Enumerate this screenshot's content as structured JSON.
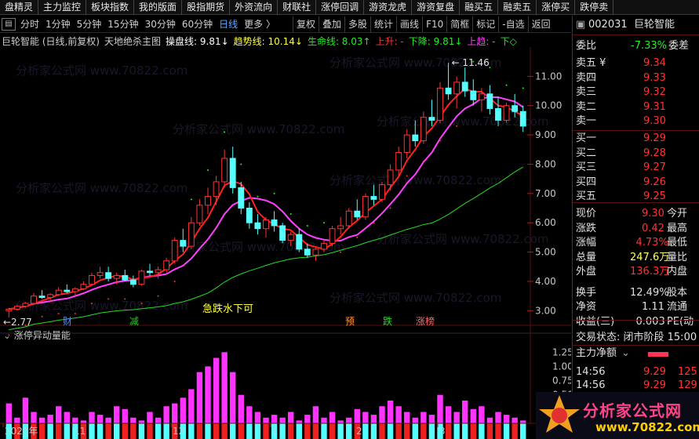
{
  "topbar": {
    "items": [
      "盘精灵",
      "主力监控",
      "板块指数",
      "我的版面",
      "股指期货",
      "外资流向",
      "财联社",
      "涨停回调",
      "游资龙虎",
      "游资复盘",
      "融买五",
      "融卖五",
      "涨停买",
      "跌停卖"
    ]
  },
  "toolbar": {
    "periods": [
      "分时",
      "1分钟",
      "5分钟",
      "15分钟",
      "30分钟",
      "60分钟",
      "日线",
      "更多 〉"
    ],
    "active": "日线",
    "tools": [
      "复权",
      "叠加",
      "多股",
      "统计",
      "画线",
      "F10",
      "简框",
      "标记",
      "-自选",
      "返回"
    ]
  },
  "legend": {
    "name": "巨轮智能 (日线,前复权)",
    "indicator": "天地绝杀主图",
    "l1": "操盘线: 9.81↓",
    "l2": "趋势线: 10.14↓",
    "l3": "生命线: 8.03↑",
    "l4": "上升: -",
    "l5": "下降: 9.81↓",
    "l6": "上趋: -",
    "l7": "下◇"
  },
  "chart": {
    "price_axis": [
      "11.00",
      "10.00",
      "9.00",
      "8.00",
      "7.00",
      "6.00",
      "5.00",
      "4.00",
      "3.00"
    ],
    "high_label": "11.46",
    "low_label": "2.77",
    "annotation": "急跌水下可",
    "markers": [
      {
        "text": "财",
        "color": "#4a90ff"
      },
      {
        "text": "减",
        "color": "#22cc22"
      },
      {
        "text": "预",
        "color": "#ff9933"
      },
      {
        "text": "跌",
        "color": "#22dd22"
      },
      {
        "text": "涨榜",
        "color": "#ff6666"
      }
    ],
    "vol_title": "涨停异动量能",
    "vol_axis": [
      "1.25",
      "1.00",
      "0.75",
      "0.50",
      "0.25"
    ],
    "time_axis": [
      "2024年",
      "11",
      "12",
      "1",
      "2",
      "3"
    ]
  },
  "chart_data": {
    "type": "candlestick",
    "y_range": [
      2.5,
      12.0
    ],
    "ohlc": [
      [
        3.0,
        3.1,
        2.77,
        3.05
      ],
      [
        3.05,
        3.2,
        3.0,
        3.15
      ],
      [
        3.15,
        3.3,
        3.1,
        3.25
      ],
      [
        3.25,
        3.6,
        3.2,
        3.5
      ],
      [
        3.5,
        3.7,
        3.4,
        3.45
      ],
      [
        3.45,
        3.6,
        3.3,
        3.55
      ],
      [
        3.55,
        3.8,
        3.5,
        3.7
      ],
      [
        3.7,
        3.9,
        3.6,
        3.65
      ],
      [
        3.65,
        3.8,
        3.5,
        3.75
      ],
      [
        3.75,
        4.0,
        3.7,
        3.9
      ],
      [
        3.9,
        4.3,
        3.85,
        4.2
      ],
      [
        4.2,
        4.5,
        4.1,
        4.3
      ],
      [
        4.3,
        4.5,
        4.0,
        4.1
      ],
      [
        4.1,
        4.3,
        3.9,
        4.2
      ],
      [
        4.2,
        4.4,
        4.0,
        4.05
      ],
      [
        4.05,
        4.2,
        3.8,
        3.9
      ],
      [
        3.9,
        4.4,
        3.85,
        4.35
      ],
      [
        4.35,
        4.6,
        4.2,
        4.3
      ],
      [
        4.3,
        4.5,
        4.1,
        4.4
      ],
      [
        4.4,
        4.8,
        4.3,
        4.7
      ],
      [
        4.7,
        5.5,
        4.6,
        5.4
      ],
      [
        5.4,
        5.8,
        5.0,
        5.2
      ],
      [
        5.2,
        6.2,
        5.1,
        6.0
      ],
      [
        6.0,
        6.8,
        5.9,
        6.6
      ],
      [
        6.6,
        7.2,
        6.3,
        6.9
      ],
      [
        6.9,
        7.6,
        6.6,
        7.4
      ],
      [
        7.4,
        8.5,
        7.2,
        8.2
      ],
      [
        8.2,
        8.6,
        7.0,
        7.2
      ],
      [
        7.2,
        7.4,
        6.3,
        6.5
      ],
      [
        6.5,
        6.7,
        5.8,
        6.0
      ],
      [
        6.0,
        6.3,
        5.6,
        5.8
      ],
      [
        5.8,
        6.2,
        5.5,
        6.1
      ],
      [
        6.1,
        6.4,
        5.7,
        5.9
      ],
      [
        5.9,
        6.0,
        5.3,
        5.4
      ],
      [
        5.4,
        5.7,
        5.2,
        5.6
      ],
      [
        5.6,
        5.8,
        5.0,
        5.1
      ],
      [
        5.1,
        5.3,
        4.8,
        4.9
      ],
      [
        4.9,
        5.2,
        4.7,
        5.1
      ],
      [
        5.1,
        5.4,
        5.0,
        5.3
      ],
      [
        5.3,
        5.9,
        5.2,
        5.8
      ],
      [
        5.8,
        6.2,
        5.6,
        5.9
      ],
      [
        5.9,
        6.5,
        5.8,
        6.4
      ],
      [
        6.4,
        6.8,
        6.1,
        6.2
      ],
      [
        6.2,
        7.0,
        6.1,
        6.9
      ],
      [
        6.9,
        7.3,
        6.6,
        6.8
      ],
      [
        6.8,
        7.4,
        6.7,
        7.3
      ],
      [
        7.3,
        8.0,
        7.1,
        7.8
      ],
      [
        7.8,
        8.6,
        7.6,
        8.4
      ],
      [
        8.4,
        9.2,
        8.2,
        9.0
      ],
      [
        9.0,
        9.5,
        8.6,
        8.8
      ],
      [
        8.8,
        9.8,
        8.7,
        9.6
      ],
      [
        9.6,
        10.2,
        9.3,
        9.5
      ],
      [
        9.5,
        10.8,
        9.4,
        10.6
      ],
      [
        10.6,
        11.46,
        10.2,
        10.4
      ],
      [
        10.4,
        11.0,
        9.9,
        10.8
      ],
      [
        10.8,
        11.3,
        10.3,
        10.5
      ],
      [
        10.5,
        10.9,
        10.0,
        10.2
      ],
      [
        10.2,
        10.6,
        9.8,
        10.4
      ],
      [
        10.4,
        10.7,
        9.7,
        9.9
      ],
      [
        9.9,
        10.3,
        9.3,
        9.5
      ],
      [
        9.5,
        10.1,
        9.4,
        10.0
      ],
      [
        10.0,
        10.4,
        9.6,
        9.8
      ],
      [
        9.8,
        10.0,
        9.1,
        9.3
      ]
    ],
    "vol": [
      0.35,
      0.1,
      0.45,
      0.2,
      0.1,
      0.15,
      0.3,
      0.2,
      0.1,
      0.05,
      0.2,
      0.15,
      0.1,
      0.3,
      0.25,
      0.1,
      0.05,
      0.2,
      0.1,
      0.3,
      0.35,
      0.45,
      0.6,
      0.9,
      1.0,
      1.15,
      1.25,
      0.9,
      0.5,
      0.3,
      0.2,
      0.1,
      0.15,
      0.1,
      0.2,
      0.05,
      0.15,
      0.3,
      0.1,
      0.2,
      0.05,
      0.1,
      0.25,
      0.2,
      0.15,
      0.3,
      0.4,
      0.3,
      0.2,
      0.1,
      0.2,
      0.15,
      0.5,
      0.3,
      0.2,
      0.4,
      0.25,
      0.3,
      0.1,
      0.2,
      0.15,
      0.1,
      0.05
    ]
  },
  "sidebar": {
    "code": "002031",
    "name": "巨轮智能",
    "weibi_label": "委比",
    "weibi": "-7.33%",
    "weicha_label": "委差",
    "asks": [
      {
        "l": "卖五",
        "p": "9.34"
      },
      {
        "l": "卖四",
        "p": "9.33"
      },
      {
        "l": "卖三",
        "p": "9.32"
      },
      {
        "l": "卖二",
        "p": "9.31"
      },
      {
        "l": "卖一",
        "p": "9.30"
      }
    ],
    "bids": [
      {
        "l": "买一",
        "p": "9.29"
      },
      {
        "l": "买二",
        "p": "9.28"
      },
      {
        "l": "买三",
        "p": "9.27"
      },
      {
        "l": "买四",
        "p": "9.26"
      },
      {
        "l": "买五",
        "p": "9.25"
      }
    ],
    "stats": [
      {
        "l": "现价",
        "v": "9.30",
        "r": "今开",
        "c": "#ff3333"
      },
      {
        "l": "涨跌",
        "v": "0.42",
        "r": "最高",
        "c": "#ff3333"
      },
      {
        "l": "涨幅",
        "v": "4.73%",
        "r": "最低",
        "c": "#ff3333"
      },
      {
        "l": "总量",
        "v": "247.6万",
        "r": "量比",
        "c": "#ffff66"
      },
      {
        "l": "外盘",
        "v": "136.3万",
        "r": "内盘",
        "c": "#ff3333"
      },
      {
        "l": "换手",
        "v": "12.49%",
        "r": "股本",
        "c": "#e0e0e0"
      },
      {
        "l": "净资",
        "v": "1.11",
        "r": "流通",
        "c": "#e0e0e0"
      },
      {
        "l": "收益(三)",
        "v": "0.003",
        "r": "PE(动",
        "c": "#e0e0e0"
      }
    ],
    "trade_state": "交易状态: 闭市阶段 15:00",
    "flow_label": "主力净额",
    "ticks": [
      {
        "t": "14:56",
        "p": "9.29",
        "v": "125"
      },
      {
        "t": "14:56",
        "p": "9.29",
        "v": "129"
      }
    ]
  },
  "watermark": "分析家公式网 www.70822.com",
  "logo": {
    "title": "分析家公式网",
    "url": "www.70822.com"
  },
  "colors": {
    "up": "#ff3333",
    "down": "#54ffff",
    "red_line": "#ff2020",
    "magenta_line": "#ff40ff",
    "green_line": "#22dd22",
    "dot_green": "#22ee22",
    "dot_red": "#ff3030"
  }
}
